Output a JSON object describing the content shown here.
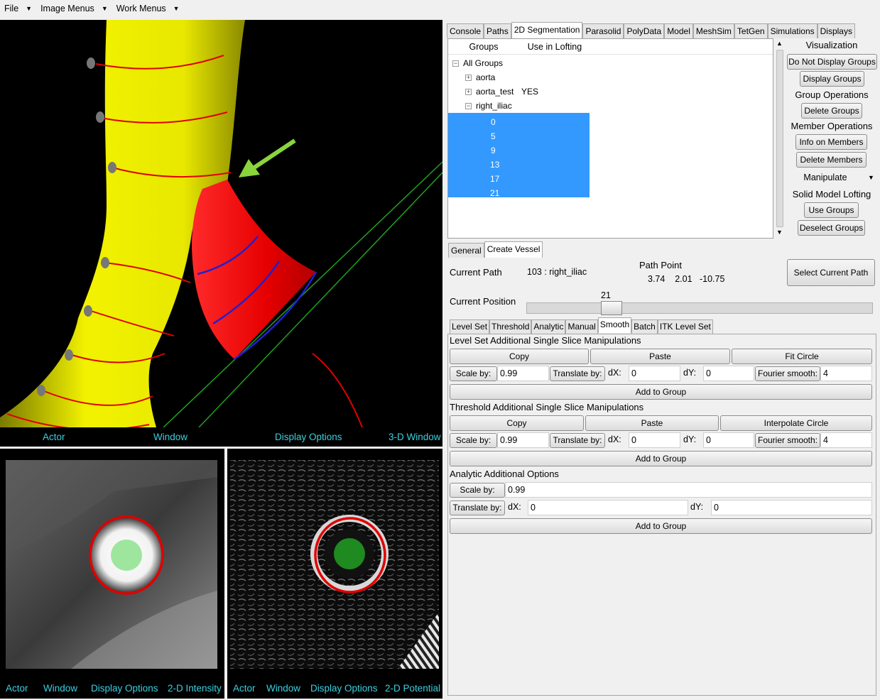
{
  "menubar": {
    "items": [
      "File",
      "Image Menus",
      "Work Menus"
    ]
  },
  "view3d": {
    "bar": [
      "Actor",
      "Window",
      "Display Options",
      "3-D Window"
    ]
  },
  "view2d_left": {
    "bar": [
      "Actor",
      "Window",
      "Display Options",
      "2-D Intensity"
    ]
  },
  "view2d_right": {
    "bar": [
      "Actor",
      "Window",
      "Display Options",
      "2-D Potential"
    ]
  },
  "tabs": [
    "Console",
    "Paths",
    "2D Segmentation",
    "Parasolid",
    "PolyData",
    "Model",
    "MeshSim",
    "TetGen",
    "Simulations",
    "Displays"
  ],
  "tree": {
    "headers": [
      "Groups",
      "Use in Lofting"
    ],
    "root": "All Groups",
    "nodes": [
      {
        "name": "aorta",
        "lofting": ""
      },
      {
        "name": "aorta_test",
        "lofting": "YES"
      },
      {
        "name": "right_iliac",
        "lofting": ""
      }
    ],
    "members": [
      "0",
      "5",
      "9",
      "13",
      "17",
      "21"
    ]
  },
  "viz": {
    "visualization": "Visualization",
    "do_not_display": "Do Not Display Groups",
    "display_groups": "Display Groups",
    "group_ops": "Group Operations",
    "delete_groups": "Delete Groups",
    "member_ops": "Member Operations",
    "info_members": "Info on Members",
    "delete_members": "Delete Members",
    "manipulate": "Manipulate",
    "solid_lofting": "Solid Model Lofting",
    "use_groups": "Use Groups",
    "deselect_groups": "Deselect Groups"
  },
  "subtabs": [
    "General",
    "Create Vessel"
  ],
  "vessel": {
    "current_path_label": "Current Path",
    "current_path_value": "103 : right_iliac",
    "path_point_label": "Path Point",
    "path_point_value": "3.74    2.01   -10.75",
    "select_current_path": "Select Current Path",
    "current_position_label": "Current Position",
    "position_value": "21",
    "slider_fraction": 0.228
  },
  "methtabs": [
    "Level Set",
    "Threshold",
    "Analytic",
    "Manual",
    "Smooth",
    "Batch",
    "ITK Level Set"
  ],
  "levelset": {
    "title": "Level Set Additional Single Slice Manipulations",
    "copy": "Copy",
    "paste": "Paste",
    "fit_circle": "Fit Circle",
    "scale_by": "Scale by:",
    "scale_value": "0.99",
    "translate_by": "Translate by:",
    "dx_label": "dX:",
    "dx_value": "0",
    "dy_label": "dY:",
    "dy_value": "0",
    "fourier": "Fourier smooth:",
    "fourier_value": "4",
    "add_to_group": "Add to Group"
  },
  "threshold": {
    "title": "Threshold Additional Single Slice Manipulations",
    "copy": "Copy",
    "paste": "Paste",
    "interp_circle": "Interpolate Circle",
    "scale_by": "Scale by:",
    "scale_value": "0.99",
    "translate_by": "Translate by:",
    "dx_label": "dX:",
    "dx_value": "0",
    "dy_label": "dY:",
    "dy_value": "0",
    "fourier": "Fourier smooth:",
    "fourier_value": "4",
    "add_to_group": "Add to Group"
  },
  "analytic": {
    "title": "Analytic Additional Options",
    "scale_by": "Scale by:",
    "scale_value": "0.99",
    "translate_by": "Translate by:",
    "dx_label": "dX:",
    "dx_value": "0",
    "dy_label": "dY:",
    "dy_value": "0",
    "add_to_group": "Add to Group"
  },
  "colors": {
    "selection": "#3399ff",
    "viewbar_text": "#3ad0e0",
    "vessel_yellow": "#f2f200",
    "branch_red": "#e60000",
    "arrow_green": "#8ad43c"
  }
}
